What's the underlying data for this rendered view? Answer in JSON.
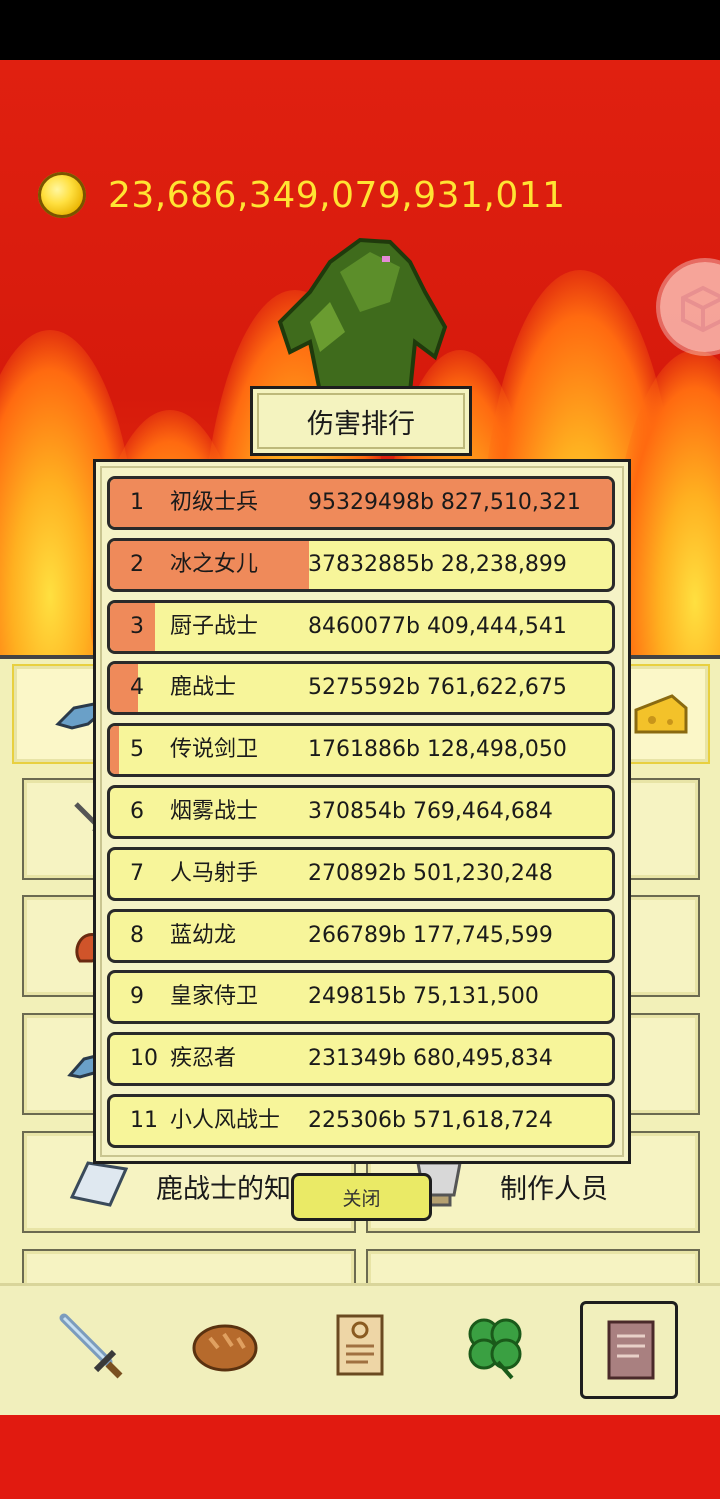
{
  "coins": {
    "amount": "23,686,349,079,931,011"
  },
  "ranking": {
    "title": "伤害排行",
    "close_label": "关闭",
    "rows": [
      {
        "rank": "1",
        "name": "初级士兵",
        "value": "95329498b 827,510,321",
        "fill": 1.0
      },
      {
        "rank": "2",
        "name": "冰之女儿",
        "value": "37832885b 28,238,899",
        "fill": 0.397
      },
      {
        "rank": "3",
        "name": "厨子战士",
        "value": "8460077b 409,444,541",
        "fill": 0.089
      },
      {
        "rank": "4",
        "name": "鹿战士",
        "value": "5275592b 761,622,675",
        "fill": 0.055
      },
      {
        "rank": "5",
        "name": "传说剑卫",
        "value": "1761886b 128,498,050",
        "fill": 0.018
      },
      {
        "rank": "6",
        "name": "烟雾战士",
        "value": "370854b 769,464,684",
        "fill": 0.0
      },
      {
        "rank": "7",
        "name": "人马射手",
        "value": "270892b 501,230,248",
        "fill": 0.0
      },
      {
        "rank": "8",
        "name": "蓝幼龙",
        "value": "266789b 177,745,599",
        "fill": 0.0
      },
      {
        "rank": "9",
        "name": "皇家侍卫",
        "value": "249815b 75,131,500",
        "fill": 0.0
      },
      {
        "rank": "10",
        "name": "疾忍者",
        "value": "231349b 680,495,834",
        "fill": 0.0
      },
      {
        "rank": "11",
        "name": "小人风战士",
        "value": "225306b 571,618,724",
        "fill": 0.0
      }
    ]
  },
  "menu": {
    "knowledge_label": "鹿战士的知识",
    "credits_label": "制作人员"
  },
  "bottom_nav": [
    {
      "icon": "sword-icon",
      "selected": false
    },
    {
      "icon": "bread-icon",
      "selected": false
    },
    {
      "icon": "scroll-icon",
      "selected": false
    },
    {
      "icon": "clover-icon",
      "selected": false
    },
    {
      "icon": "book-icon",
      "selected": true
    }
  ],
  "colors": {
    "background_red": "#d01a0c",
    "coin_text": "#ffe433",
    "row_fill": "#ef8a5a",
    "row_bg": "#f7f59a",
    "panel_bg": "#f5f3c6"
  }
}
